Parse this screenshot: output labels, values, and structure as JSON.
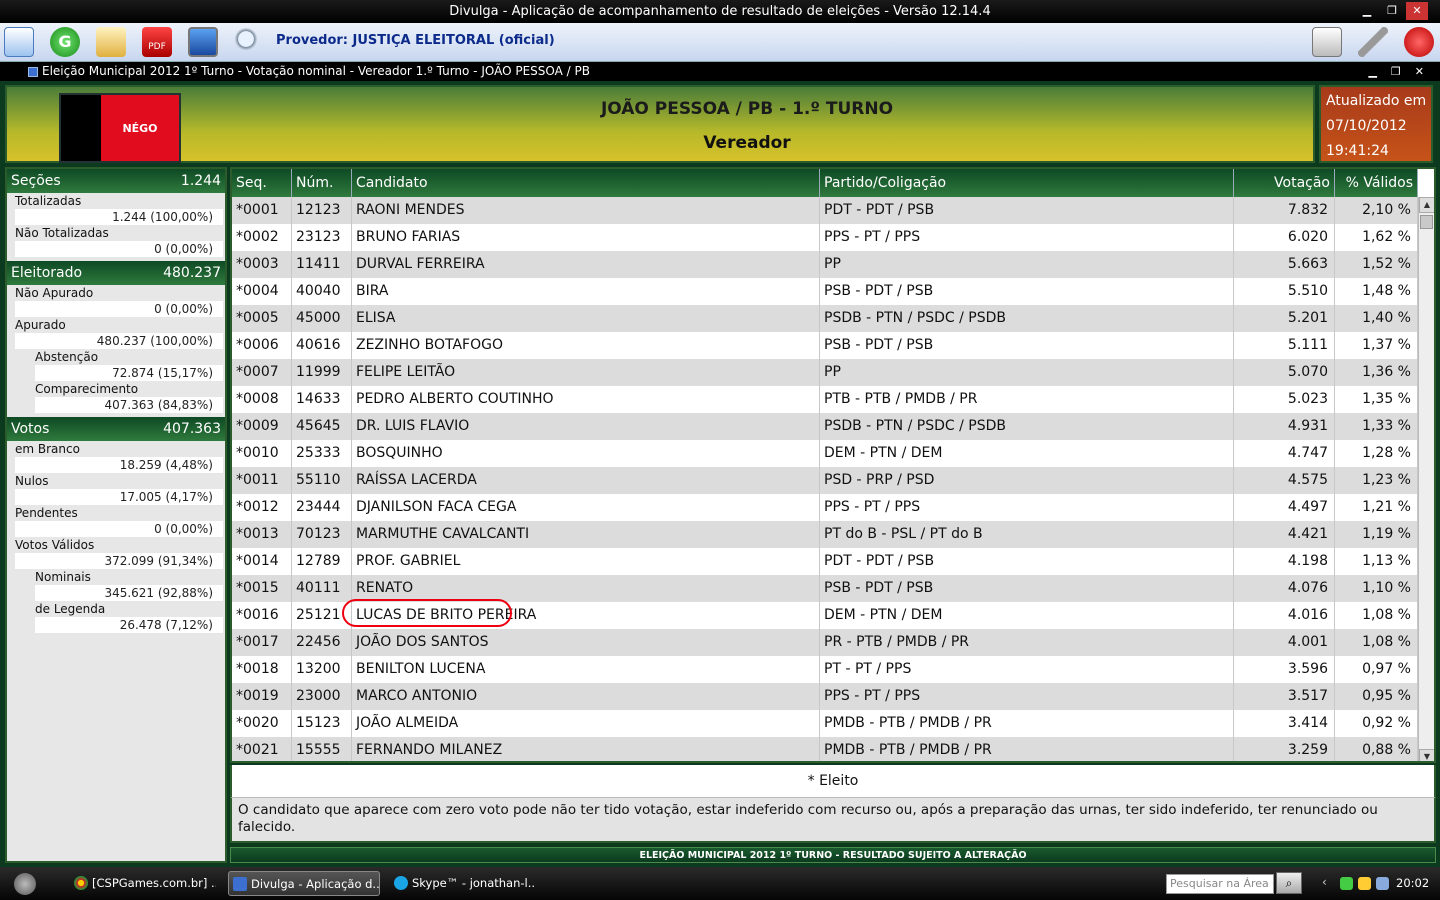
{
  "window": {
    "title": "Divulga - Aplicação de acompanhamento de resultado de eleições - Versão 12.14.4",
    "provider_label": "Provedor: JUSTIÇA ELEITORAL (oficial)",
    "subtitle": "Eleição Municipal 2012 1º Turno - Votação nominal - Vereador 1.º Turno - JOÃO PESSOA / PB"
  },
  "header": {
    "flag_text": "NÉGO",
    "city": "JOÃO PESSOA / PB - 1.º TURNO",
    "office": "Vereador",
    "updated_label": "Atualizado em",
    "updated_date": "07/10/2012",
    "updated_time": "19:41:24"
  },
  "sidebar": {
    "secoes": {
      "title": "Seções",
      "value": "1.244",
      "totalizadas_label": "Totalizadas",
      "totalizadas_value": "1.244 (100,00%)",
      "nao_totalizadas_label": "Não Totalizadas",
      "nao_totalizadas_value": "0 (0,00%)"
    },
    "eleitorado": {
      "title": "Eleitorado",
      "value": "480.237",
      "nao_apurado_label": "Não Apurado",
      "nao_apurado_value": "0 (0,00%)",
      "apurado_label": "Apurado",
      "apurado_value": "480.237 (100,00%)",
      "abstencao_label": "Abstenção",
      "abstencao_value": "72.874 (15,17%)",
      "comparecimento_label": "Comparecimento",
      "comparecimento_value": "407.363 (84,83%)"
    },
    "votos": {
      "title": "Votos",
      "value": "407.363",
      "branco_label": "em Branco",
      "branco_value": "18.259 (4,48%)",
      "nulos_label": "Nulos",
      "nulos_value": "17.005 (4,17%)",
      "pendentes_label": "Pendentes",
      "pendentes_value": "0 (0,00%)",
      "validos_label": "Votos Válidos",
      "validos_value": "372.099 (91,34%)",
      "nominais_label": "Nominais",
      "nominais_value": "345.621 (92,88%)",
      "legenda_label": "de Legenda",
      "legenda_value": "26.478 (7,12%)"
    }
  },
  "table": {
    "headers": {
      "seq": "Seq.",
      "num": "Núm.",
      "candidato": "Candidato",
      "partido": "Partido/Coligação",
      "votacao": "Votação",
      "pct": "% Válidos"
    },
    "rows": [
      [
        "*0001",
        "12123",
        "RAONI MENDES",
        "PDT - PDT / PSB",
        "7.832",
        "2,10 %"
      ],
      [
        "*0002",
        "23123",
        "BRUNO FARIAS",
        "PPS - PT / PPS",
        "6.020",
        "1,62 %"
      ],
      [
        "*0003",
        "11411",
        "DURVAL FERREIRA",
        "PP",
        "5.663",
        "1,52 %"
      ],
      [
        "*0004",
        "40040",
        "BIRA",
        "PSB - PDT / PSB",
        "5.510",
        "1,48 %"
      ],
      [
        "*0005",
        "45000",
        "ELISA",
        "PSDB - PTN / PSDC / PSDB",
        "5.201",
        "1,40 %"
      ],
      [
        "*0006",
        "40616",
        "ZEZINHO BOTAFOGO",
        "PSB - PDT / PSB",
        "5.111",
        "1,37 %"
      ],
      [
        "*0007",
        "11999",
        "FELIPE LEITÃO",
        "PP",
        "5.070",
        "1,36 %"
      ],
      [
        "*0008",
        "14633",
        "PEDRO ALBERTO COUTINHO",
        "PTB - PTB / PMDB / PR",
        "5.023",
        "1,35 %"
      ],
      [
        "*0009",
        "45645",
        "DR. LUIS FLAVIO",
        "PSDB - PTN / PSDC / PSDB",
        "4.931",
        "1,33 %"
      ],
      [
        "*0010",
        "25333",
        "BOSQUINHO",
        "DEM - PTN / DEM",
        "4.747",
        "1,28 %"
      ],
      [
        "*0011",
        "55110",
        "RAÍSSA LACERDA",
        "PSD - PRP / PSD",
        "4.575",
        "1,23 %"
      ],
      [
        "*0012",
        "23444",
        "DJANILSON FACA CEGA",
        "PPS - PT / PPS",
        "4.497",
        "1,21 %"
      ],
      [
        "*0013",
        "70123",
        "MARMUTHE CAVALCANTI",
        "PT do B - PSL / PT do B",
        "4.421",
        "1,19 %"
      ],
      [
        "*0014",
        "12789",
        "PROF. GABRIEL",
        "PDT - PDT / PSB",
        "4.198",
        "1,13 %"
      ],
      [
        "*0015",
        "40111",
        "RENATO",
        "PSB - PDT / PSB",
        "4.076",
        "1,10 %"
      ],
      [
        "*0016",
        "25121",
        "LUCAS DE BRITO PEREIRA",
        "DEM - PTN / DEM",
        "4.016",
        "1,08 %"
      ],
      [
        "*0017",
        "22456",
        "JOÃO DOS SANTOS",
        "PR - PTB / PMDB / PR",
        "4.001",
        "1,08 %"
      ],
      [
        "*0018",
        "13200",
        "BENILTON LUCENA",
        "PT - PT / PPS",
        "3.596",
        "0,97 %"
      ],
      [
        "*0019",
        "23000",
        "MARCO ANTONIO",
        "PPS - PT / PPS",
        "3.517",
        "0,95 %"
      ],
      [
        "*0020",
        "15123",
        "JOÃO ALMEIDA",
        "PMDB - PTB / PMDB / PR",
        "3.414",
        "0,92 %"
      ],
      [
        "*0021",
        "15555",
        "FERNANDO MILANEZ",
        "PMDB - PTB / PMDB / PR",
        "3.259",
        "0,88 %"
      ]
    ]
  },
  "legend": "* Eleito",
  "note": "O candidato que aparece com zero voto pode não ter tido votação, estar indeferido com recurso ou, após a preparação das urnas, ter sido indeferido, ter renunciado ou falecido.",
  "footer": "ELEIÇÃO MUNICIPAL 2012 1º TURNO - RESULTADO SUJEITO A ALTERAÇÃO",
  "taskbar": {
    "task1": "[CSPGames.com.br] ...",
    "task2": "Divulga - Aplicação d...",
    "task3": "Skype™ - jonathan-l...",
    "search_placeholder": "Pesquisar na Área de",
    "clock": "20:02"
  },
  "colors": {
    "header_green": "#0e4a24",
    "updated_bg": "#b8461a",
    "highlight": "#e01010"
  }
}
